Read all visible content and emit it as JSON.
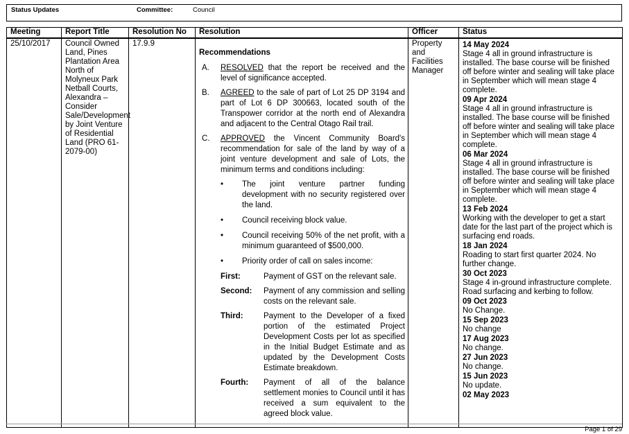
{
  "header": {
    "status_label": "Status Updates",
    "committee_label": "Committee:",
    "committee_value": "Council"
  },
  "table": {
    "columns": [
      "Meeting",
      "Report Title",
      "Resolution No",
      "Resolution",
      "Officer",
      "Status"
    ],
    "row": {
      "meeting": "25/10/2017",
      "report_title": "Council Owned Land, Pines Plantation Area North of Molyneux Park Netball Courts, Alexandra – Consider Sale/Development by Joint Venture of Residential Land (PRO 61-2079-00)",
      "resolution_no": "17.9.9",
      "officer": "Property and Facilities Manager"
    }
  },
  "resolution": {
    "heading": "Recommendations",
    "items": [
      {
        "letter": "A.",
        "keyword": "RESOLVED",
        "text": " that the report be received and the level of significance accepted."
      },
      {
        "letter": "B.",
        "keyword": "AGREED",
        "text": " to the sale of part of Lot 25 DP 3194 and part of Lot 6 DP 300663, located south of the Transpower corridor at the north end of Alexandra and adjacent to the Central Otago Rail trail."
      },
      {
        "letter": "C.",
        "keyword": "APPROVED",
        "text": " the Vincent Community Board's recommendation for sale of the land by way of a joint venture development and sale of Lots, the minimum terms and conditions including:"
      }
    ],
    "bullets": [
      "The joint venture partner funding development with no security registered over the land.",
      "Council receiving block value.",
      "Council receiving 50% of the net profit, with a minimum guaranteed of $500,000.",
      "Priority order of call on sales income:"
    ],
    "orders": [
      {
        "label": "First:",
        "text": "Payment of GST on the relevant sale."
      },
      {
        "label": "Second:",
        "text": "Payment of any commission and selling costs on the relevant sale."
      },
      {
        "label": "Third:",
        "text": "Payment to the Developer of a fixed portion of the estimated Project Development Costs per lot as specified in the Initial Budget Estimate and as updated by the Development Costs Estimate breakdown."
      },
      {
        "label": "Fourth:",
        "text": "Payment of all of the balance settlement monies to Council until it has received a sum equivalent to the agreed block value."
      }
    ]
  },
  "status": [
    {
      "date": "14 May 2024",
      "text": "Stage 4 all in ground infrastructure is installed. The base course will be finished off before winter and sealing will take place in September which will mean stage 4 complete."
    },
    {
      "date": "09 Apr 2024",
      "text": "Stage 4 all in ground infrastructure is installed. The base course will be finished off before winter and sealing will take place in September which will mean stage 4 complete."
    },
    {
      "date": "06 Mar 2024",
      "text": "Stage 4 all in ground infrastructure is installed. The base course will be finished off before winter and sealing will take place in September which will mean stage 4 complete."
    },
    {
      "date": "13 Feb 2024",
      "text": "Working with the developer to get a start date for the last part of the project which is surfacing end roads."
    },
    {
      "date": "18 Jan 2024",
      "text": "Roading to start first quarter 2024. No further change."
    },
    {
      "date": "30 Oct 2023",
      "text": "Stage 4 in-ground infrastructure complete. Road surfacing and kerbing to follow."
    },
    {
      "date": "09 Oct 2023",
      "text": "No Change."
    },
    {
      "date": "15 Sep 2023",
      "text": "No change"
    },
    {
      "date": "17 Aug 2023",
      "text": "No change."
    },
    {
      "date": "27 Jun 2023",
      "text": "No change."
    },
    {
      "date": "15 Jun 2023",
      "text": "No update."
    },
    {
      "date": "02 May 2023",
      "text": ""
    }
  ],
  "footer": {
    "page": "Page 1 of 29"
  }
}
